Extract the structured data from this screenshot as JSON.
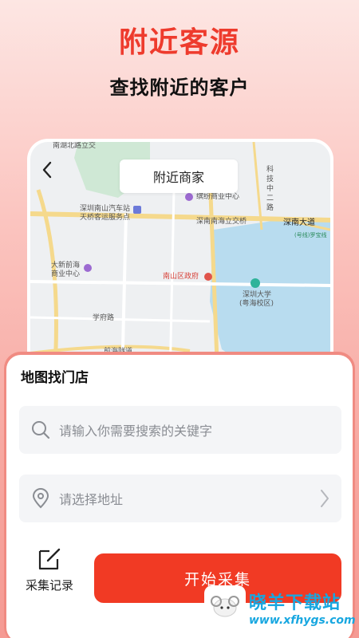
{
  "promo": {
    "title": "附近客源",
    "subtitle": "查找附近的客户"
  },
  "map_view": {
    "header_title": "附近商家",
    "labels": {
      "top_cut": "南湖北路立交",
      "bus_station": "深圳南山汽车站",
      "bus_station2": "天桥客运服务点",
      "mall": "缤纷商业中心",
      "interchange": "深南南海立交桥",
      "avenue": "深南大道",
      "road_tag": "(号线)罗宝线",
      "tech_road1": "科",
      "tech_road2": "技",
      "tech_road3": "中",
      "tech_road4": "二",
      "tech_road5": "路",
      "new_center1": "大新前海",
      "new_center2": "商业中心",
      "gov": "南山区政府",
      "univ1": "深圳大学",
      "univ2": "(粤海校区)",
      "xuefu": "学府路",
      "tunnel": "前海隧道"
    },
    "colors": {
      "park": "#cfe8d5",
      "water": "#b8dcef",
      "road_major": "#f5d98c",
      "road_minor": "#ffffff"
    }
  },
  "search_panel": {
    "title": "地图找门店",
    "keyword_placeholder": "请输入你需要搜索的关键字",
    "address_placeholder": "请选择地址",
    "history_label": "采集记录",
    "start_button": "开始采集"
  },
  "watermark": {
    "title": "晓羊下载站",
    "url": "www.xfhygs.com"
  }
}
